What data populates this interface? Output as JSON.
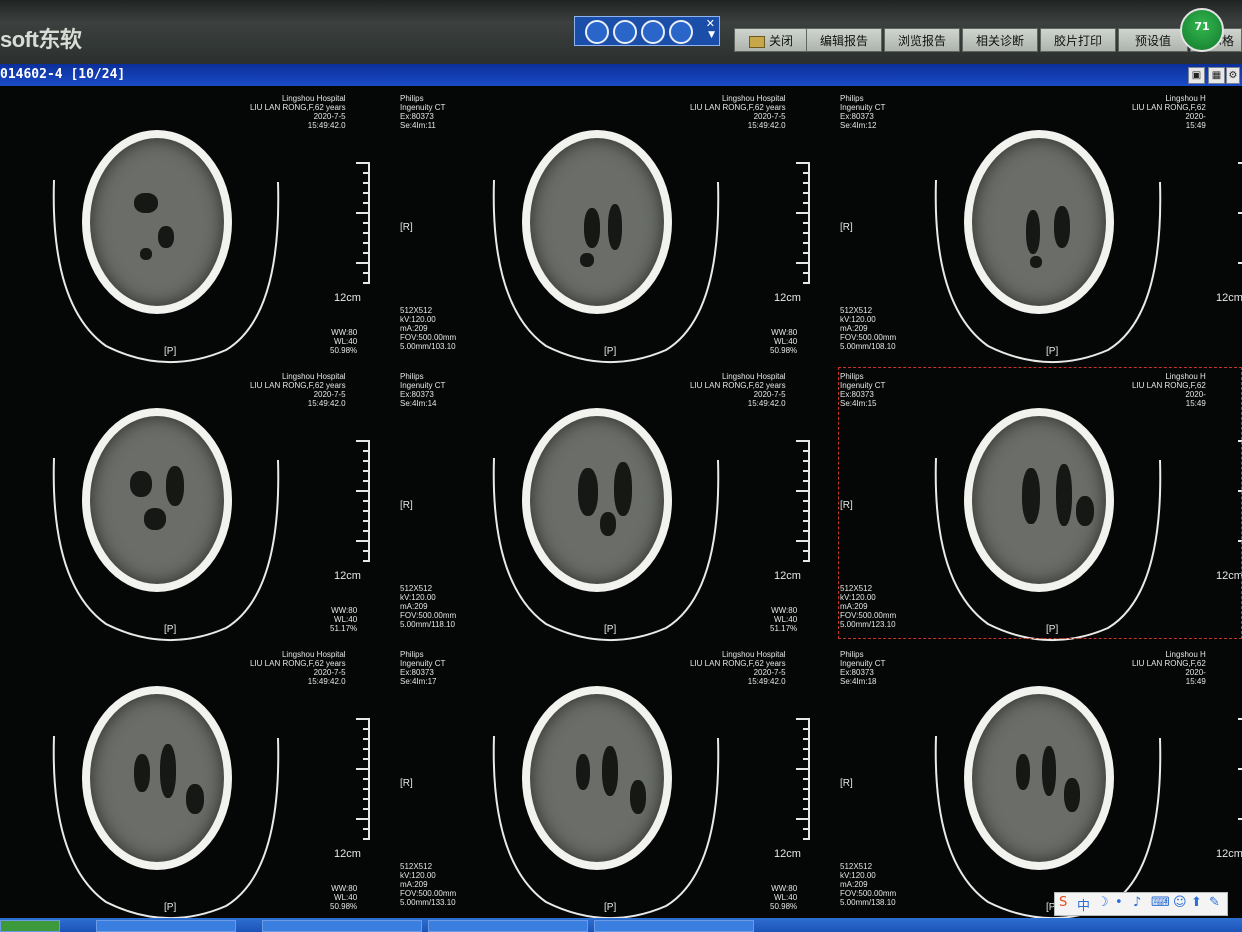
{
  "app": {
    "logo": "soft东软",
    "title": "014602-4 [10/24]",
    "badge": "71"
  },
  "toolbar": {
    "buttons": [
      "关闭",
      "编辑报告",
      "浏览报告",
      "相关诊断",
      "胶片打印",
      "预设值",
      "显示格"
    ]
  },
  "images": [
    {
      "hospital": "Lingshou Hospital",
      "patient": "LIU LAN RONG,F,62 years",
      "date": "2020-7-5",
      "time": "15:49:42.0",
      "vendor": "Philips",
      "model": "Ingenuity CT",
      "ex": "Ex:80373",
      "se": "Se:4Im:11",
      "matrix": "512X512",
      "kv": "kV:120.00",
      "ma": "mA:209",
      "fov": "FOV:500.00mm",
      "slice": "5.00mm/103.10",
      "ww": "WW:80",
      "wl": "WL:40",
      "zoom": "50.98%",
      "scale": "12cm",
      "orient_r": "[R]",
      "orient_p": "[P]"
    },
    {
      "hospital": "Lingshou Hospital",
      "patient": "LIU LAN RONG,F,62 years",
      "date": "2020-7-5",
      "time": "15:49:42.0",
      "vendor": "Philips",
      "model": "Ingenuity CT",
      "ex": "Ex:80373",
      "se": "Se:4Im:12",
      "matrix": "512X512",
      "kv": "kV:120.00",
      "ma": "mA:209",
      "fov": "FOV:500.00mm",
      "slice": "5.00mm/108.10",
      "ww": "WW:80",
      "wl": "WL:40",
      "zoom": "50.98%",
      "scale": "12cm",
      "orient_r": "[R]",
      "orient_p": "[P]"
    },
    {
      "hospital": "Lingshou H",
      "patient": "LIU LAN RONG,F,62",
      "date": "2020-",
      "time": "15:49",
      "vendor": "",
      "model": "",
      "ex": "",
      "se": "",
      "matrix": "",
      "kv": "",
      "ma": "",
      "fov": "",
      "slice": "",
      "ww": "",
      "wl": "",
      "zoom": "",
      "scale": "12cm",
      "orient_r": "[R]",
      "orient_p": "[P]"
    },
    {
      "hospital": "Lingshou Hospital",
      "patient": "LIU LAN RONG,F,62 years",
      "date": "2020-7-5",
      "time": "15:49:42.0",
      "vendor": "Philips",
      "model": "Ingenuity CT",
      "ex": "Ex:80373",
      "se": "Se:4Im:14",
      "matrix": "512X512",
      "kv": "kV:120.00",
      "ma": "mA:209",
      "fov": "FOV:500.00mm",
      "slice": "5.00mm/118.10",
      "ww": "WW:80",
      "wl": "WL:40",
      "zoom": "51.17%",
      "scale": "12cm",
      "orient_r": "[R]",
      "orient_p": "[P]"
    },
    {
      "hospital": "Lingshou Hospital",
      "patient": "LIU LAN RONG,F,62 years",
      "date": "2020-7-5",
      "time": "15:49:42.0",
      "vendor": "Philips",
      "model": "Ingenuity CT",
      "ex": "Ex:80373",
      "se": "Se:4Im:15",
      "matrix": "512X512",
      "kv": "kV:120.00",
      "ma": "mA:209",
      "fov": "FOV:500.00mm",
      "slice": "5.00mm/123.10",
      "ww": "WW:80",
      "wl": "WL:40",
      "zoom": "51.17%",
      "scale": "12cm",
      "orient_r": "[R]",
      "orient_p": "[P]"
    },
    {
      "hospital": "Lingshou H",
      "patient": "LIU LAN RONG,F,62",
      "date": "2020-",
      "time": "15:49",
      "vendor": "",
      "model": "",
      "ex": "",
      "se": "",
      "matrix": "",
      "kv": "",
      "ma": "",
      "fov": "",
      "slice": "",
      "ww": "",
      "wl": "",
      "zoom": "",
      "scale": "12cm",
      "orient_r": "[R]",
      "orient_p": "[P]"
    },
    {
      "hospital": "Lingshou Hospital",
      "patient": "LIU LAN RONG,F,62 years",
      "date": "2020-7-5",
      "time": "15:49:42.0",
      "vendor": "Philips",
      "model": "Ingenuity CT",
      "ex": "Ex:80373",
      "se": "Se:4Im:17",
      "matrix": "512X512",
      "kv": "kV:120.00",
      "ma": "mA:209",
      "fov": "FOV:500.00mm",
      "slice": "5.00mm/133.10",
      "ww": "WW:80",
      "wl": "WL:40",
      "zoom": "50.98%",
      "scale": "12cm",
      "orient_r": "[R]",
      "orient_p": "[P]"
    },
    {
      "hospital": "Lingshou Hospital",
      "patient": "LIU LAN RONG,F,62 years",
      "date": "2020-7-5",
      "time": "15:49:42.0",
      "vendor": "Philips",
      "model": "Ingenuity CT",
      "ex": "Ex:80373",
      "se": "Se:4Im:18",
      "matrix": "512X512",
      "kv": "kV:120.00",
      "ma": "mA:209",
      "fov": "FOV:500.00mm",
      "slice": "5.00mm/138.10",
      "ww": "WW:80",
      "wl": "WL:40",
      "zoom": "50.98%",
      "scale": "12cm",
      "orient_r": "[R]",
      "orient_p": "[P]"
    },
    {
      "hospital": "Lingshou H",
      "patient": "LIU LAN RONG,F,62",
      "date": "2020-",
      "time": "15:49",
      "vendor": "",
      "model": "",
      "ex": "",
      "se": "",
      "matrix": "",
      "kv": "",
      "ma": "",
      "fov": "",
      "slice": "",
      "ww": "",
      "wl": "",
      "zoom": "",
      "scale": "12cm",
      "orient_r": "[R]",
      "orient_p": "[P]"
    }
  ],
  "ime": {
    "label": "中"
  },
  "colors": {
    "title_blue": "#1a4bc7",
    "selection": "#c8332b",
    "badge_green": "#33b64f"
  }
}
